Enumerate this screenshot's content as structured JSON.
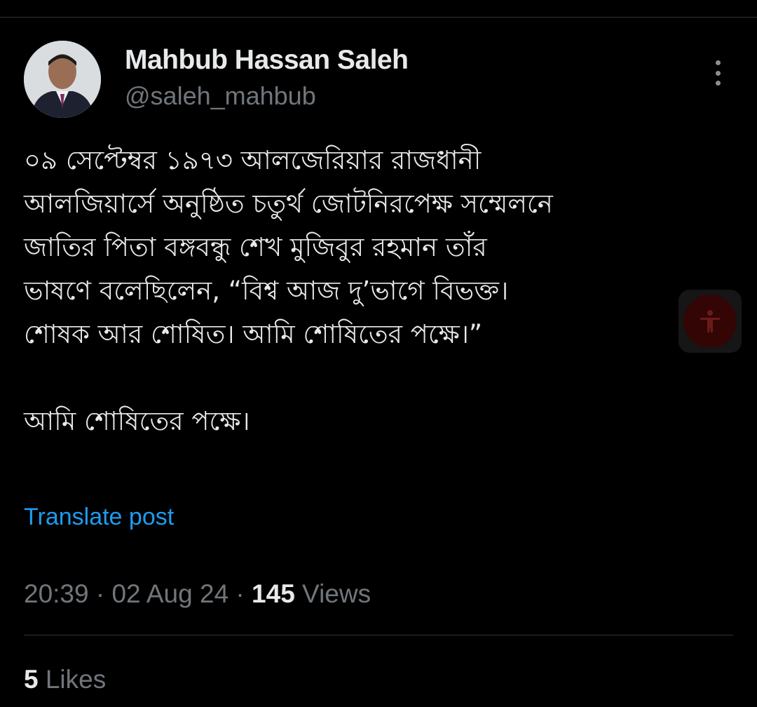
{
  "author": {
    "name": "Mahbub Hassan Saleh",
    "handle": "@saleh_mahbub"
  },
  "post": {
    "lines": [
      "০৯ সেপ্টেম্বর ১৯৭৩ আলজেরিয়ার রাজধানী",
      "আলজিয়ার্সে অনুষ্ঠিত চতুর্থ জোটনিরপেক্ষ সম্মেলনে",
      "জাতির পিতা বঙ্গবন্ধু শেখ মুজিবুর রহমান তাঁর",
      "ভাষণে বলেছিলেন, “বিশ্ব আজ দু’ভাগে বিভক্ত।",
      "শোষক আর শোষিত। আমি শোষিতের পক্ষে।”",
      "",
      "আমি শোষিতের পক্ষে।"
    ],
    "translate_label": "Translate post"
  },
  "meta": {
    "time": "20:39",
    "separator": " · ",
    "date": "02 Aug 24",
    "views_count": "145",
    "views_label": " Views"
  },
  "engagement": {
    "likes_count": "5",
    "likes_label": " Likes"
  },
  "icons": {
    "more": "more-vertical-icon",
    "accessibility": "accessibility-icon"
  },
  "colors": {
    "background": "#000000",
    "text": "#e7e9ea",
    "secondary": "#71767b",
    "link": "#1d9bf0",
    "divider": "#2f3336"
  }
}
